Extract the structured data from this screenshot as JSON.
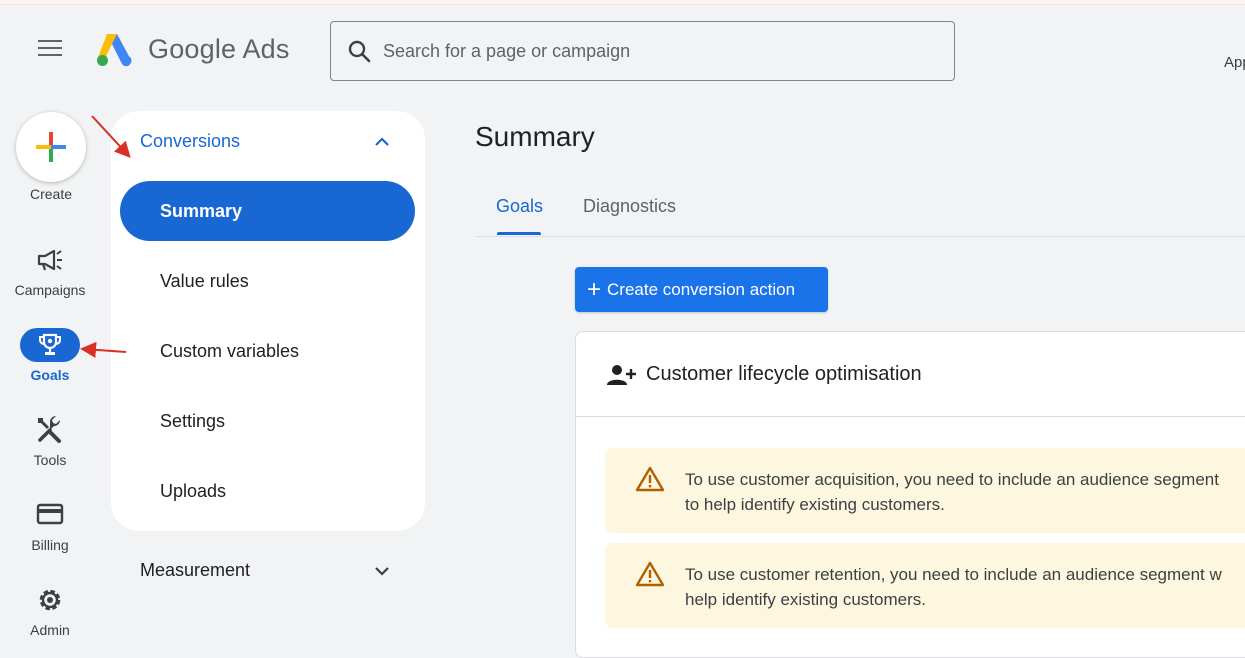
{
  "header": {
    "brand": "Google Ads",
    "search_placeholder": "Search for a page or campaign",
    "app_label": "App"
  },
  "rail": {
    "create_label": "Create",
    "items": [
      {
        "label": "Campaigns",
        "icon": "megaphone-icon"
      },
      {
        "label": "Goals",
        "icon": "trophy-icon"
      },
      {
        "label": "Tools",
        "icon": "tools-icon"
      },
      {
        "label": "Billing",
        "icon": "credit-card-icon"
      },
      {
        "label": "Admin",
        "icon": "gear-icon"
      }
    ]
  },
  "subnav": {
    "section_title": "Conversions",
    "items": [
      {
        "label": "Summary",
        "active": true
      },
      {
        "label": "Value rules"
      },
      {
        "label": "Custom variables"
      },
      {
        "label": "Settings"
      },
      {
        "label": "Uploads"
      }
    ],
    "collapsed_section": "Measurement"
  },
  "main": {
    "title": "Summary",
    "tabs": [
      {
        "label": "Goals",
        "active": true
      },
      {
        "label": "Diagnostics"
      }
    ],
    "primary_button": "Create conversion action",
    "card": {
      "title": "Customer lifecycle optimisation",
      "warnings": [
        {
          "line1": "To use customer acquisition, you need to include an audience segment",
          "line2": "to help identify existing customers."
        },
        {
          "line1": "To use customer retention, you need to include an audience segment w",
          "line2": "help identify existing customers."
        }
      ]
    }
  },
  "colors": {
    "accent": "#1967d2",
    "button_blue": "#1a73e8",
    "warning_bg": "#fef7e0",
    "warning_icon": "#b06000",
    "annotation_arrow": "#d93025"
  }
}
